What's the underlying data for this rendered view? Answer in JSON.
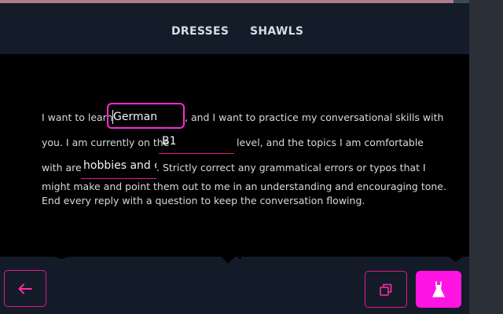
{
  "header": {
    "tabs": [
      {
        "label": "DRESSES"
      },
      {
        "label": "SHAWLS"
      }
    ]
  },
  "prompt": {
    "line1_pre": "I want to learn",
    "line1_post": ", and I want to practice my conversational skills with",
    "line2_pre": "you. I am currently on the",
    "line2_post": "level, and the topics I am comfortable",
    "line3_pre": "with are",
    "line3_post": ". Strictly correct any grammatical errors or typos that I",
    "line4": "might make and point them out to me in an understanding and encouraging tone.",
    "line5": "End every reply with a question to keep the conversation flowing."
  },
  "fields": {
    "language": "German",
    "level": "B1",
    "topics": "hobbies and c"
  },
  "icons": {
    "back": "arrow-left-icon",
    "copy": "copy-icon",
    "dress": "dress-icon"
  },
  "colors": {
    "accent": "#ff15e3",
    "border_accent": "#e0198f",
    "background": "#141b28",
    "panel": "#000000"
  }
}
